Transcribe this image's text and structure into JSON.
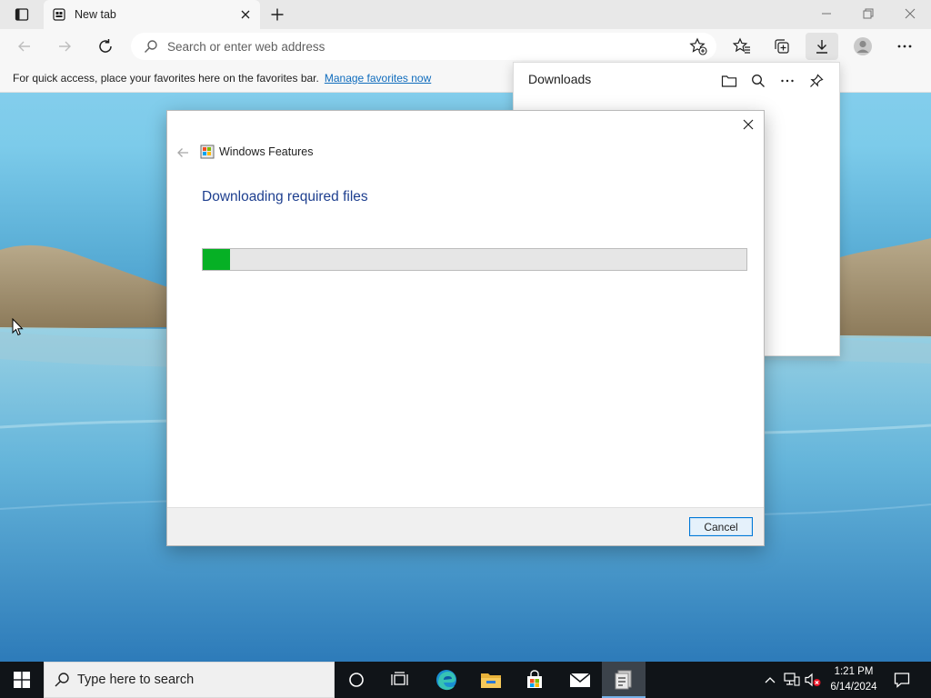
{
  "colors": {
    "accent": "#0f6cbd",
    "progress": "#06b025",
    "dialog_heading": "#1e3f8f",
    "taskbar": "#101418"
  },
  "browser": {
    "tab": {
      "title": "New tab",
      "icon": "new-tab-page-icon"
    },
    "address_bar": {
      "placeholder": "Search or enter web address"
    },
    "favorites_bar": {
      "message": "For quick access, place your favorites here on the favorites bar.",
      "link": "Manage favorites now"
    },
    "toolbar_icons": [
      "back-icon",
      "forward-icon",
      "refresh-icon",
      "search-icon",
      "add-favorite-icon",
      "favorites-icon",
      "collections-icon",
      "download-icon",
      "profile-icon",
      "more-icon"
    ]
  },
  "downloads": {
    "title": "Downloads",
    "icons": [
      "folder-icon",
      "search-icon",
      "more-icon",
      "pin-icon"
    ]
  },
  "dialog": {
    "title": "Windows Features",
    "heading": "Downloading required files",
    "progress": 0.05,
    "cancel_label": "Cancel"
  },
  "taskbar": {
    "search_placeholder": "Type here to search",
    "apps": [
      "cortana-icon",
      "task-view-icon",
      "edge-icon",
      "file-explorer-icon",
      "store-icon",
      "mail-icon",
      "windows-features-icon"
    ],
    "clock": {
      "time": "1:21 PM",
      "date": "6/14/2024"
    }
  }
}
